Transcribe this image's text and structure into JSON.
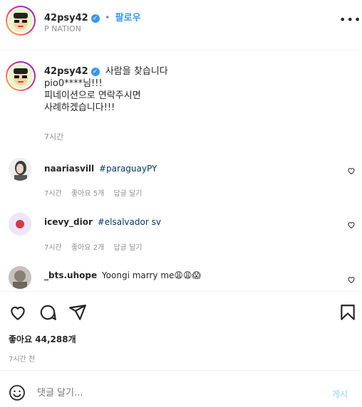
{
  "header": {
    "username": "42psy42",
    "follow_label": "팔로우",
    "dot": "•",
    "subtitle": "P NATION",
    "more_icon": "more-icon"
  },
  "caption": {
    "username": "42psy42",
    "text_line1": "사람을 찾습니다",
    "text_line2": "pio0****님!!!",
    "text_line3": "피네이션으로 연락주시면",
    "text_line4": "사례하겠습니다!!!",
    "time": "7시간"
  },
  "comments": [
    {
      "username": "naariasvill",
      "text": "#paraguayPY",
      "time": "7시간",
      "likes": "좋아요 5개",
      "reply": "답글 달기"
    },
    {
      "username": "icevy_dior",
      "text": "#elsalvador sv",
      "time": "7시간",
      "likes": "좋아요 2개",
      "reply": "답글 달기"
    },
    {
      "username": "_bts.uhope",
      "text": "Yoongi marry me😩😩😱"
    }
  ],
  "actions": {
    "icons": [
      "heart-icon",
      "comment-icon",
      "share-icon",
      "bookmark-icon"
    ]
  },
  "likes": {
    "label": "좋아요 44,288개"
  },
  "post_time": {
    "label": "7시간 전"
  },
  "comment_box": {
    "placeholder": "댓글 달기...",
    "submit_label": "게시"
  },
  "colors": {
    "accent": "#3897f0",
    "hashtag": "#00376b",
    "muted": "#8e8e8e",
    "submit": "#b2dffc"
  }
}
